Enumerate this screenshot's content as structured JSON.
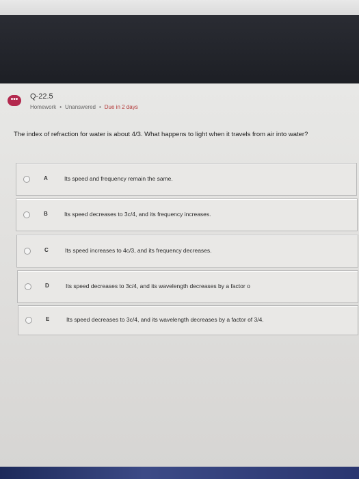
{
  "assignment": {
    "question_id": "Q-22.5",
    "type": "Homework",
    "status": "Unanswered",
    "due": "Due in 2 days",
    "badge_icon": "chat-ellipsis-icon",
    "badge_text": "•••"
  },
  "question": {
    "prompt": "The index of refraction for water is about 4/3. What happens to light when it travels from air into water?"
  },
  "options": [
    {
      "letter": "A",
      "text": "Its speed and frequency remain the same."
    },
    {
      "letter": "B",
      "text": "Its speed decreases to 3c/4, and its frequency increases."
    },
    {
      "letter": "C",
      "text": "Its speed increases to 4c/3, and its frequency decreases."
    },
    {
      "letter": "D",
      "text": "Its speed decreases to 3c/4, and its wavelength decreases by a factor o"
    },
    {
      "letter": "E",
      "text": "Its speed decreases to 3c/4, and its wavelength decreases by a factor of 3/4."
    }
  ],
  "colors": {
    "badge": "#b3294e",
    "due": "#b23636",
    "header_band": "#1d1f25"
  }
}
